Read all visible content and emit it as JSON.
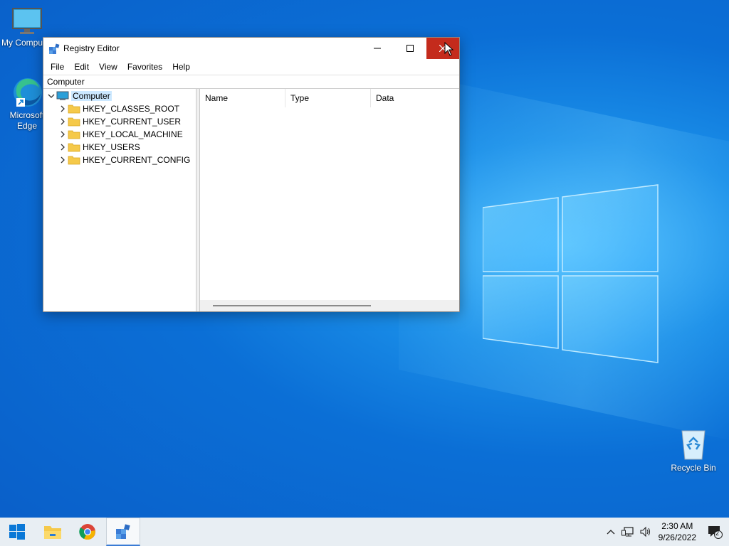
{
  "desktop": {
    "icons": [
      {
        "label": "My Computer",
        "name": "my-computer"
      },
      {
        "label": "Microsoft Edge",
        "name": "microsoft-edge"
      },
      {
        "label": "Recycle Bin",
        "name": "recycle-bin"
      }
    ]
  },
  "window": {
    "title": "Registry Editor",
    "menu": [
      "File",
      "Edit",
      "View",
      "Favorites",
      "Help"
    ],
    "address": "Computer",
    "tree": {
      "root": "Computer",
      "children": [
        "HKEY_CLASSES_ROOT",
        "HKEY_CURRENT_USER",
        "HKEY_LOCAL_MACHINE",
        "HKEY_USERS",
        "HKEY_CURRENT_CONFIG"
      ]
    },
    "columns": [
      "Name",
      "Type",
      "Data"
    ]
  },
  "taskbar": {
    "time": "2:30 AM",
    "date": "9/26/2022",
    "notification_count": "2"
  },
  "colors": {
    "close_button": "#c42b1c",
    "selection": "#cce8ff",
    "accent": "#0a5ec8"
  }
}
